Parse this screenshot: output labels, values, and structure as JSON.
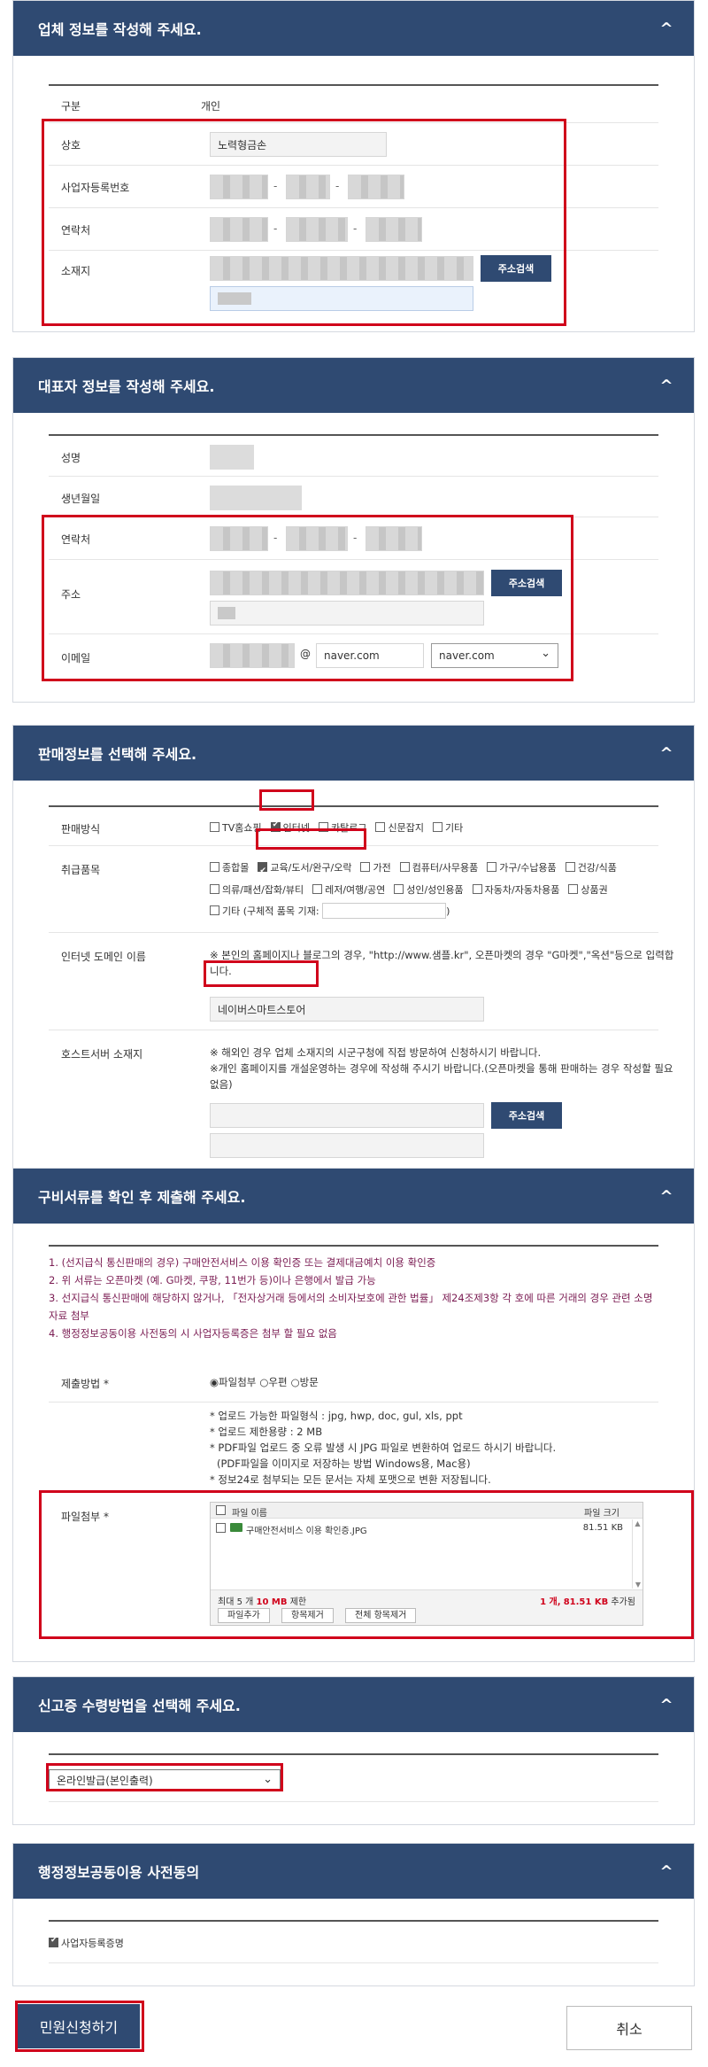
{
  "section1": {
    "title": "업체 정보를 작성해 주세요.",
    "toggle": "^",
    "type_label": "구분",
    "type_value": "개인",
    "name_label": "상호",
    "name_value": "노력형금손",
    "biznum_label": "사업자등록번호",
    "phone_label": "연락처",
    "address_label": "소재지",
    "address_button": "주소검색",
    "dash": "-"
  },
  "section2": {
    "title": "대표자 정보를 작성해 주세요.",
    "toggle": "^",
    "name_label": "성명",
    "birth_label": "생년월일",
    "phone_label": "연락처",
    "address_label": "주소",
    "address_button": "주소검색",
    "email_label": "이메일",
    "email_at": "@",
    "email_domain": "naver.com",
    "email_select": "naver.com",
    "dash": "-"
  },
  "section3": {
    "title": "판매정보를 선택해 주세요.",
    "toggle": "^",
    "method_label": "판매방식",
    "methods": [
      {
        "label": "TV홈쇼핑",
        "checked": false
      },
      {
        "label": "인터넷",
        "checked": true
      },
      {
        "label": "카탈로그",
        "checked": false
      },
      {
        "label": "신문잡지",
        "checked": false
      },
      {
        "label": "기타",
        "checked": false
      }
    ],
    "items_label": "취급품목",
    "items": [
      {
        "label": "종합몰",
        "checked": false
      },
      {
        "label": "교육/도서/완구/오락",
        "checked": true
      },
      {
        "label": "가전",
        "checked": false
      },
      {
        "label": "컴퓨터/사무용품",
        "checked": false
      },
      {
        "label": "가구/수납용품",
        "checked": false
      },
      {
        "label": "건강/식품",
        "checked": false
      },
      {
        "label": "의류/패션/잡화/뷰티",
        "checked": false
      },
      {
        "label": "레저/여행/공연",
        "checked": false
      },
      {
        "label": "성인/성인용품",
        "checked": false
      },
      {
        "label": "자동차/자동차용품",
        "checked": false
      },
      {
        "label": "상품권",
        "checked": false
      }
    ],
    "items_other": "기타 (구체적 품목 기재:",
    "items_other_close": ")",
    "domain_label": "인터넷 도메인 이름",
    "domain_note": "※ 본인의 홈페이지나 블로그의 경우, \"http://www.샘플.kr\", 오픈마켓의 경우 \"G마켓\",\"옥션\"등으로 입력합니다.",
    "domain_value": "네이버스마트스토어",
    "host_label": "호스트서버 소재지",
    "host_note1": "※ 해외인 경우 업체 소재지의 시군구청에 직접 방문하여 신청하시기 바랍니다.",
    "host_note2": "※개인 홈페이지를 개설운영하는 경우에 작성해 주시기 바랍니다.(오픈마켓을 통해 판매하는 경우 작성할 필요 없음)",
    "host_button": "주소검색"
  },
  "section4": {
    "title": "구비서류를 확인 후 제출해 주세요.",
    "toggle": "^",
    "notes": [
      "1. (선지급식 통신판매의 경우) 구매안전서비스 이용 확인증 또는 결제대금예치 이용 확인증",
      "2. 위 서류는 오픈마켓 (예. G마켓, 쿠팡, 11번가 등)이나 은행에서 발급 가능",
      "3. 선지급식 통신판매에 해당하지 않거나, 「전자상거래 등에서의 소비자보호에 관한 법률」 제24조제3항 각 호에 따른 거래의 경우 관련 소명자료 첨부",
      "4. 행정정보공동이용 사전동의 시 사업자등록증은 첨부 할 필요 없음"
    ],
    "submit_label": "제출방법 *",
    "submit_options": [
      {
        "label": "파일첨부",
        "selected": true
      },
      {
        "label": "우편",
        "selected": false
      },
      {
        "label": "방문",
        "selected": false
      }
    ],
    "file_notes": [
      "* 업로드 가능한 파일형식 : jpg, hwp, doc, gul, xls, ppt",
      "* 업로드 제한용량 : 2 MB",
      "* PDF파일 업로드 중 오류 발생 시 JPG 파일로 변환하여 업로드 하시기 바랍니다.",
      "(PDF파일을 이미지로 저장하는 방법  Windows용, Mac용)",
      "* 정보24로 첨부되는 모든 문서는 자체 포맷으로 변환 저장됩니다."
    ],
    "attach_label": "파일첨부 *",
    "file_col_name": "파일 이름",
    "file_col_size": "파일 크기",
    "files": [
      {
        "name": "구매안전서비스 이용 확인증.JPG",
        "size": "81.51 KB"
      }
    ],
    "limit_prefix": "최대 5 개",
    "limit_size": "10 MB",
    "limit_suffix": "제한",
    "count_prefix": "1 개,",
    "count_size": "81.51 KB",
    "count_suffix": "추가됨",
    "add_button": "파일추가",
    "remove_button": "항목제거",
    "remove_all_button": "전체 항목제거"
  },
  "section5": {
    "title": "신고증 수령방법을 선택해 주세요.",
    "toggle": "^",
    "select_value": "온라인발급(본인출력)"
  },
  "section6": {
    "title": "행정정보공동이용 사전동의",
    "toggle": "^",
    "consent_label": "사업자등록증명",
    "consent_checked": true
  },
  "footer": {
    "apply_button": "민원신청하기",
    "cancel_button": "취소"
  },
  "colors": {
    "header": "#2f4a72",
    "highlight": "#d0021b",
    "notes": "#7a1b52"
  }
}
